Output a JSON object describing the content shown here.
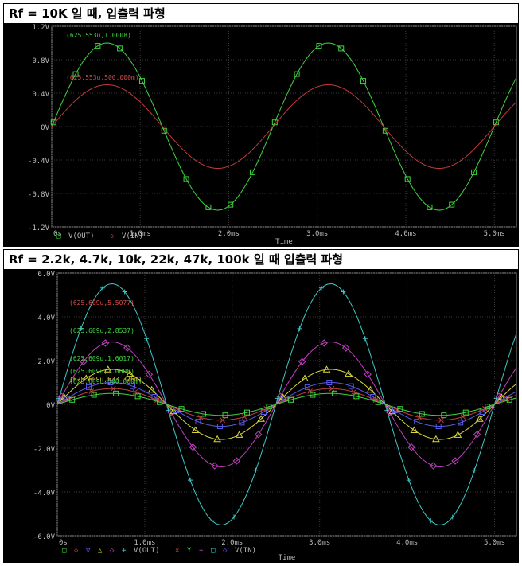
{
  "header1": "Rf = 10K 일 때, 입출력 파형",
  "header2": "Rf = 2.2k, 4.7k, 10k, 22k, 47k, 100k 일 때 입출력 파형",
  "chart_data": [
    {
      "type": "line",
      "title": "",
      "xlabel": "Time",
      "xlim": [
        0,
        5.25
      ],
      "ylim": [
        -1.2,
        1.2
      ],
      "x_unit": "ms",
      "yticks": [
        "1.2V",
        "0.8V",
        "0.4V",
        "0V",
        "-0.4V",
        "-0.8V",
        "-1.2V"
      ],
      "ytick_values": [
        1.2,
        0.8,
        0.4,
        0,
        -0.4,
        -0.8,
        -1.2
      ],
      "xticks": [
        "0s",
        "1.0ms",
        "2.0ms",
        "3.0ms",
        "4.0ms",
        "5.0ms"
      ],
      "xtick_values": [
        0,
        1,
        2,
        3,
        4,
        5
      ],
      "frequency_khz": 0.4,
      "series": [
        {
          "name": "V(OUT)",
          "amplitude": 1.0,
          "color": "#3ed63e",
          "marker": "square"
        },
        {
          "name": "V(IN)",
          "amplitude": 0.5,
          "color": "#c23a3a",
          "marker": "none"
        }
      ],
      "legend": [
        {
          "label": "V(OUT)",
          "symbol": "□",
          "color": "#3ed63e"
        },
        {
          "label": "V(IN)",
          "symbol": "◇",
          "color": "#c23a3a"
        }
      ],
      "annotations": [
        {
          "text": "(625.553u,1.0008)",
          "color": "#3ed63e"
        },
        {
          "text": "(625.553u,500.000m)",
          "color": "#d04a4a"
        }
      ]
    },
    {
      "type": "line",
      "title": "",
      "xlabel": "Time",
      "xlim": [
        0,
        5.25
      ],
      "ylim": [
        -6.0,
        6.0
      ],
      "x_unit": "ms",
      "yticks": [
        "6.0V",
        "4.0V",
        "2.0V",
        "0V",
        "-2.0V",
        "-4.0V",
        "-6.0V"
      ],
      "ytick_values": [
        6,
        4,
        2,
        0,
        -2,
        -4,
        -6
      ],
      "xticks": [
        "0s",
        "1.0ms",
        "2.0ms",
        "3.0ms",
        "4.0ms",
        "5.0ms"
      ],
      "xtick_values": [
        0,
        1,
        2,
        3,
        4,
        5
      ],
      "frequency_khz": 0.4,
      "series": [
        {
          "amplitude": 5.5077,
          "color": "#3fc8c8",
          "marker": "plus"
        },
        {
          "amplitude": 2.8537,
          "color": "#c040c0",
          "marker": "diamond"
        },
        {
          "amplitude": 1.6017,
          "color": "#d8d83a",
          "marker": "triangle"
        },
        {
          "amplitude": 1.0008,
          "color": "#5a5ae8",
          "marker": "square"
        },
        {
          "amplitude": 0.72,
          "color": "#c04040",
          "marker": "x"
        },
        {
          "amplitude": 0.5,
          "color": "#3ed63e",
          "marker": "square"
        }
      ],
      "legend": [
        {
          "label": "V(OUT)",
          "symbols": [
            {
              "s": "□",
              "c": "#3ed63e"
            },
            {
              "s": "◇",
              "c": "#c04040"
            },
            {
              "s": "▽",
              "c": "#5a5ae8"
            },
            {
              "s": "△",
              "c": "#d8d83a"
            },
            {
              "s": "◇",
              "c": "#c040c0"
            },
            {
              "s": "+",
              "c": "#3fc8c8"
            }
          ]
        },
        {
          "label": "V(IN)",
          "symbols": [
            {
              "s": "×",
              "c": "#c04040"
            },
            {
              "s": "Y",
              "c": "#3ed63e"
            },
            {
              "s": "+",
              "c": "#c040c0"
            },
            {
              "s": "□",
              "c": "#3fc8c8"
            },
            {
              "s": "◇",
              "c": "#5a5ae8"
            }
          ]
        }
      ],
      "annotations": [
        {
          "text": "(625.609u,5.5077)",
          "color": "#e04a4a"
        },
        {
          "text": "(625.609u,2.8537)",
          "color": "#3ed63e"
        },
        {
          "text": "(625.609u,1.6017)",
          "color": "#3ed63e"
        },
        {
          "text": "(625.609u,1.0008)",
          "color": "#3ed63e"
        },
        {
          "text": "(625.609u,633.376m)",
          "color": "#d8d83a"
        },
        {
          "text": "(625.609u,500.000m)",
          "color": "#3ed63e"
        }
      ]
    }
  ]
}
